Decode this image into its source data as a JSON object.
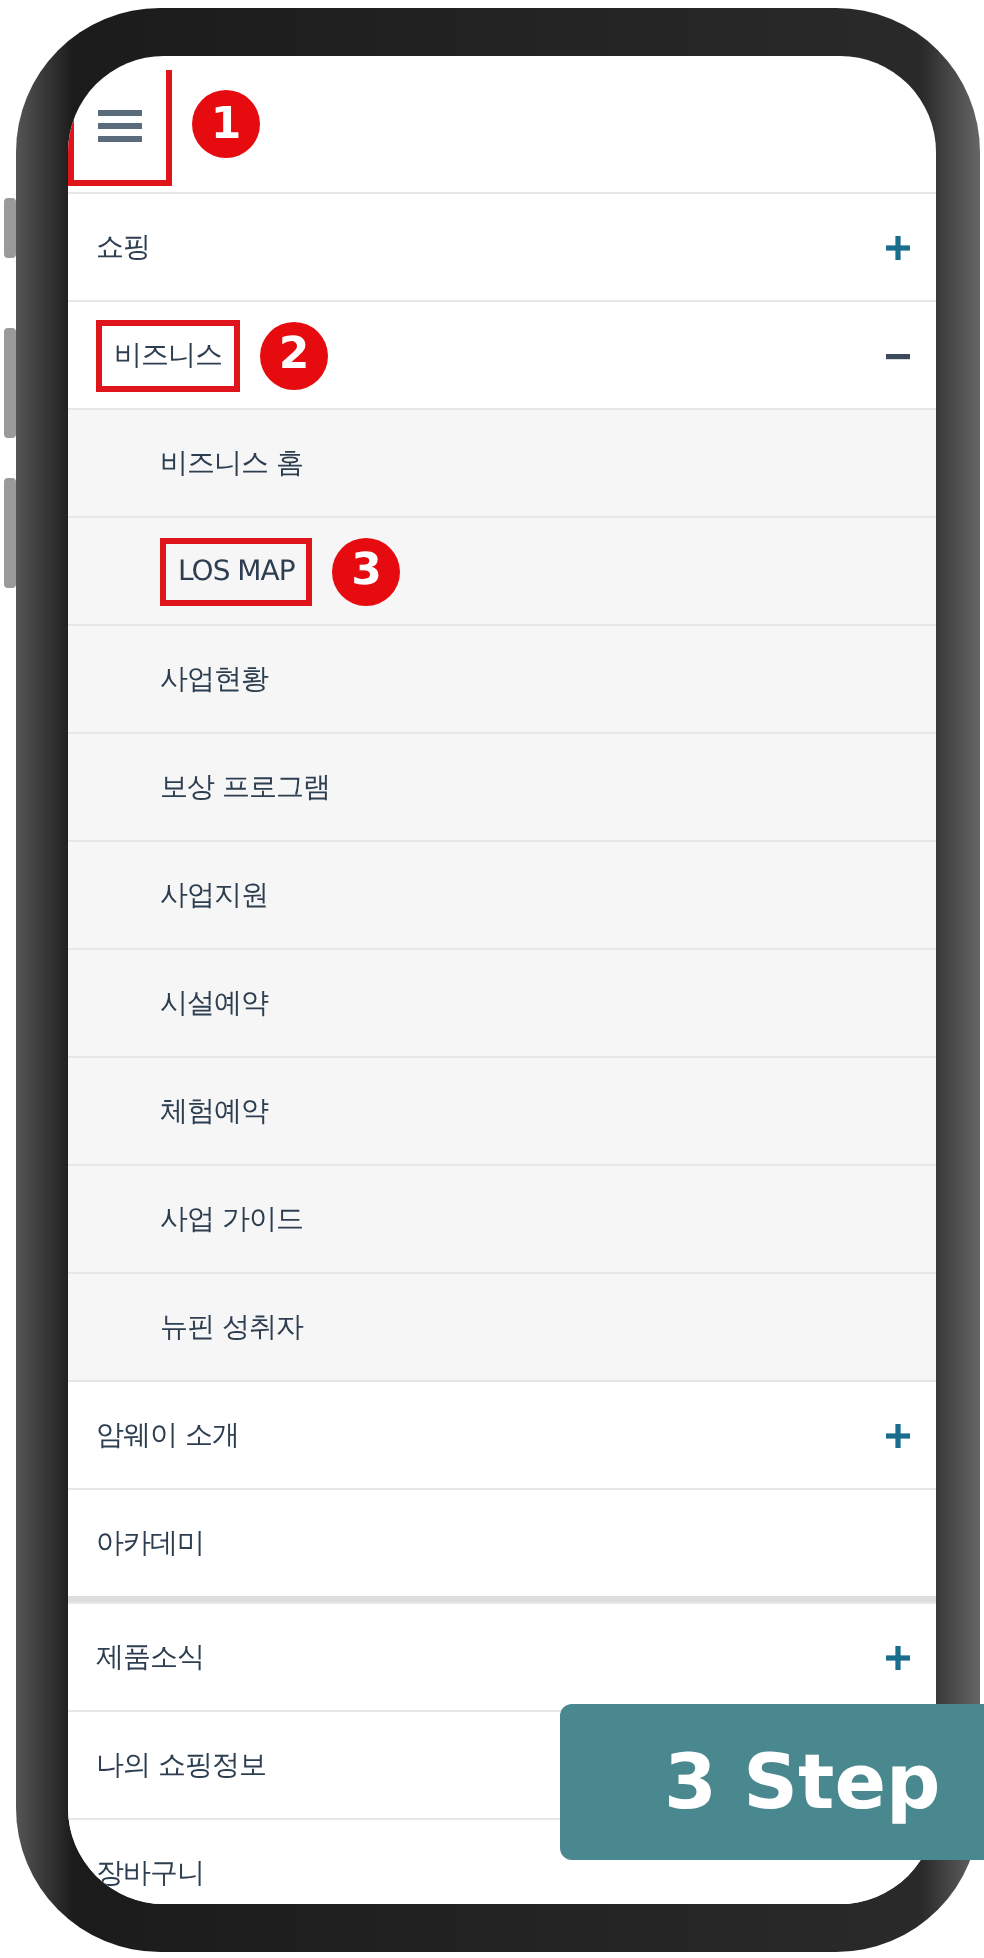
{
  "header": {
    "callout": "1",
    "highlighted": true
  },
  "sections": [
    {
      "items": [
        {
          "label": "쇼핑",
          "expandable": true,
          "expanded": false,
          "highlighted": false
        },
        {
          "label": "비즈니스",
          "expandable": true,
          "expanded": true,
          "highlighted": true,
          "callout": "2",
          "children": [
            {
              "label": "비즈니스 홈",
              "highlighted": false
            },
            {
              "label": "LOS MAP",
              "highlighted": true,
              "callout": "3"
            },
            {
              "label": "사업현황",
              "highlighted": false
            },
            {
              "label": "보상 프로그램",
              "highlighted": false
            },
            {
              "label": "사업지원",
              "highlighted": false
            },
            {
              "label": "시설예약",
              "highlighted": false
            },
            {
              "label": "체험예약",
              "highlighted": false
            },
            {
              "label": "사업 가이드",
              "highlighted": false
            },
            {
              "label": "뉴핀 성취자",
              "highlighted": false
            }
          ]
        },
        {
          "label": "암웨이 소개",
          "expandable": true,
          "expanded": false,
          "highlighted": false
        },
        {
          "label": "아카데미",
          "expandable": false,
          "highlighted": false
        }
      ]
    },
    {
      "items": [
        {
          "label": "제품소식",
          "expandable": true,
          "expanded": false,
          "highlighted": false
        },
        {
          "label": "나의 쇼핑정보",
          "expandable": false,
          "highlighted": false
        },
        {
          "label": "장바구니",
          "expandable": false,
          "highlighted": false
        }
      ]
    }
  ],
  "banner": {
    "text": "3 Step"
  }
}
